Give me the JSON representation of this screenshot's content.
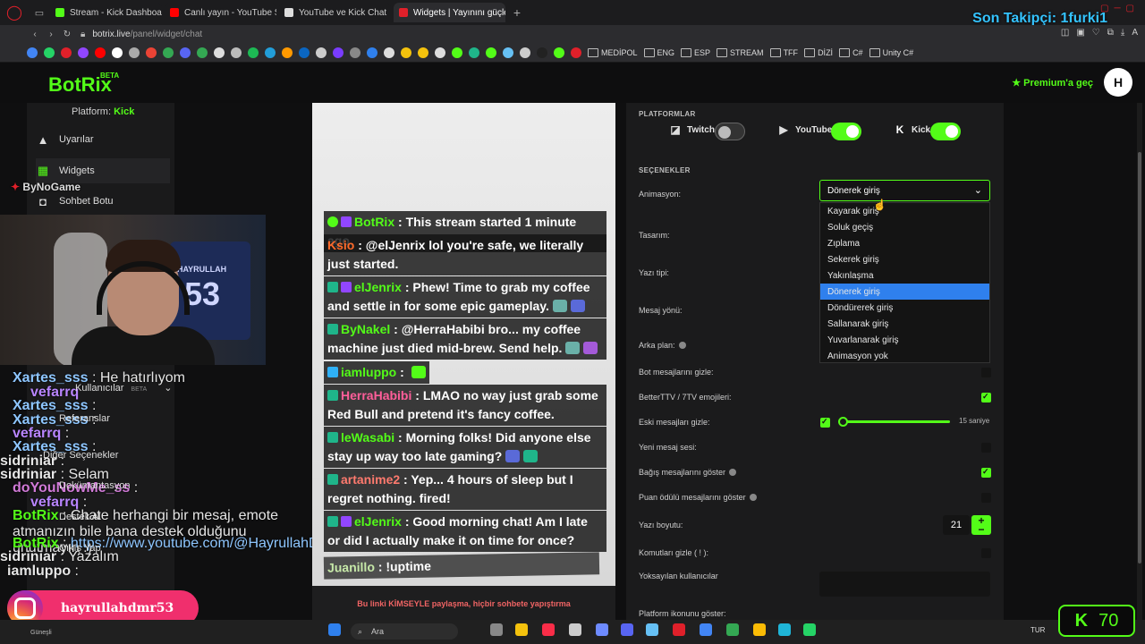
{
  "browser": {
    "tabs": [
      {
        "title": "Stream - Kick Dashboard",
        "color": "#53fc18"
      },
      {
        "title": "Canlı yayın - YouTube Stud",
        "color": "#ff0000"
      },
      {
        "title": "YouTube ve Kick Chat",
        "color": "#dddddd"
      },
      {
        "title": "Widgets | Yayınını güçlendi",
        "color": "#e0202a"
      }
    ],
    "url_host": "botrix.live",
    "url_path": "/panel/widget/chat",
    "bookmarks_folders": [
      "MEDİPOL",
      "ENG",
      "ESP",
      "STREAM",
      "TFF",
      "DİZİ",
      "C#",
      "Unity C#"
    ],
    "follower_overlay": "Son Takipçi: 1furki1"
  },
  "app": {
    "logo": "BotRix",
    "logo_badge": "BETA",
    "premium_label": "Premium'a geç",
    "avatar_letter": "H",
    "platform_label": "Platform:",
    "platform_value": "Kick",
    "sidebar": [
      {
        "label": "Uyarılar",
        "icon": "warning-icon"
      },
      {
        "label": "Widgets",
        "icon": "grid-icon"
      },
      {
        "label": "Sohbet Botu",
        "icon": "robot-icon"
      },
      {
        "label": "Kullanıcılar",
        "icon": "users-icon",
        "badge": "BETA"
      },
      {
        "label": "Referanslar",
        "icon": "link-icon"
      },
      {
        "label": "Diğer Seçenekler",
        "icon": "settings-icon"
      },
      {
        "label": "Dokümantasyon",
        "icon": "book-icon"
      },
      {
        "label": "Destek Al",
        "icon": "help-icon"
      },
      {
        "label": "Çıkış Yap",
        "icon": "logout-icon"
      }
    ]
  },
  "webcam": {
    "jersey_name": "HAYRULLAH",
    "jersey_number": "53",
    "sponsor": "ByNoGame"
  },
  "overlay_chat": [
    {
      "user": "Xartes_sss",
      "text": "He hatırlıyom"
    },
    {
      "user": "vefarrq",
      "text": ""
    },
    {
      "user": "Xartes_sss",
      "text": ""
    },
    {
      "user": "Xartes_sss",
      "text": ""
    },
    {
      "user": "vefarrq",
      "text": ""
    },
    {
      "user": "Xartes_sss",
      "text": ""
    },
    {
      "user": "sidriniar",
      "text": ""
    },
    {
      "user": "sidriniar",
      "text": "Selam"
    },
    {
      "user": "doYouNowMe_ss",
      "text": ""
    },
    {
      "user": "vefarrq",
      "text": ""
    },
    {
      "user": "BotRix",
      "text": "Chate herhangi bir mesaj, emote atmanızın bile bana destek olduğunu unutmayın :)"
    },
    {
      "user": "BotRix",
      "text": "https://www.youtube.com/@HayrullahDemir"
    },
    {
      "user": "sidriniar",
      "text": "Yazalım"
    },
    {
      "user": "iamluppo",
      "text": ""
    }
  ],
  "instagram": {
    "handle": "hayrullahdmr53"
  },
  "preview": {
    "messages": [
      {
        "user": "BotRix",
        "color": "#53fc18",
        "text": "This stream started 1 minute ago."
      },
      {
        "user": "Ksio",
        "color": "#ff6a2a",
        "text": "@elJenrix lol you're safe, we literally just started."
      },
      {
        "user": "elJenrix",
        "color": "#53fc18",
        "text": "Phew! Time to grab my coffee and settle in for some epic gameplay."
      },
      {
        "user": "ByNakel",
        "color": "#53fc18",
        "text": "@HerraHabibi bro... my coffee machine just died mid-brew. Send help."
      },
      {
        "user": "iamluppo",
        "color": "#53fc18",
        "text": ""
      },
      {
        "user": "HerraHabibi",
        "color": "#ff5e9a",
        "text": "LMAO no way  just grab some Red Bull and pretend it's fancy coffee."
      },
      {
        "user": "leWasabi",
        "color": "#53fc18",
        "text": "Morning folks! Did anyone else stay up way too late gaming?"
      },
      {
        "user": "artanime2",
        "color": "#ff7a6e",
        "text": "Yep... 4 hours of sleep but I regret nothing. fired!"
      },
      {
        "user": "elJenrix",
        "color": "#53fc18",
        "text": "Good morning chat! Am I late or did I actually make it on time for once?"
      },
      {
        "user": "Juanillo",
        "color": "#c6e8a8",
        "text": "!uptime"
      }
    ],
    "footer_warning": "Bu linki KİMSEYLE paylaşma, hiçbir sohbete yapıştırma"
  },
  "settings": {
    "platforms_title": "PLATFORMLAR",
    "platforms": [
      {
        "name": "Twitch",
        "enabled": false
      },
      {
        "name": "YouTube",
        "enabled": true
      },
      {
        "name": "Kick",
        "enabled": true
      }
    ],
    "options_title": "SEÇENEKLER",
    "animation_label": "Animasyon:",
    "animation_value": "Dönerek giriş",
    "animation_options": [
      "Kayarak giriş",
      "Soluk geçiş",
      "Zıplama",
      "Sekerek giriş",
      "Yakınlaşma",
      "Dönerek giriş",
      "Döndürerek giriş",
      "Sallanarak giriş",
      "Yuvarlanarak giriş",
      "Animasyon yok"
    ],
    "animation_selected_index": 5,
    "labels": {
      "design": "Tasarım:",
      "font": "Yazı tipi:",
      "direction": "Mesaj yönü:",
      "background": "Arka plan:",
      "hide_bot": "Bot mesajlarını gizle:",
      "bttv": "BetterTTV / 7TV emojileri:",
      "hide_old": "Eski mesajları gizle:",
      "new_sound": "Yeni mesaj sesi:",
      "donations": "Bağış mesajlarını göster",
      "points": "Puan ödülü mesajlarını göster",
      "font_size": "Yazı boyutu:",
      "hide_commands": "Komutları gizle ( ! ):",
      "ignored_users": "Yoksayılan kullanıcılar",
      "platform_icon": "Platform ikonunu göster:"
    },
    "toggles": {
      "hide_bot": false,
      "bttv": true,
      "hide_old": true,
      "new_sound": false,
      "donations": true,
      "points": false,
      "hide_commands": false
    },
    "hide_old_value": "15 saniye",
    "font_size_value": "21",
    "stepper_plus": "+",
    "stepper_minus": "−"
  },
  "kick_counter": {
    "letter": "K",
    "value": "70"
  },
  "taskbar": {
    "search_label": "Ara",
    "lang": "TUR",
    "weather": "Güneşli"
  },
  "colors": {
    "accent": "#53fc18",
    "follower": "#34c3ff",
    "select_highlight": "#2f80ed"
  }
}
